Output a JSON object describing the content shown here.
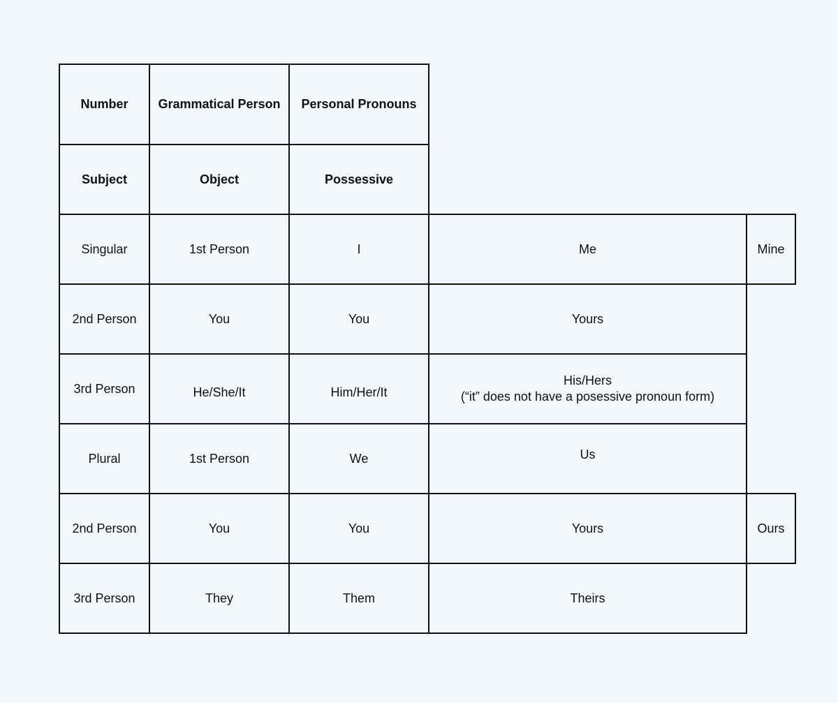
{
  "table": {
    "header_row_1": {
      "number": "Number",
      "grammatical_person": "Grammatical Person",
      "personal_pronouns": "Personal Pronouns"
    },
    "header_row_2": {
      "subject": "Subject",
      "object": "Object",
      "possessive": "Possessive"
    },
    "rows": [
      {
        "col1": "Singular",
        "col2": "1st Person",
        "col3": "I",
        "col4": "Me",
        "col5": "Mine"
      },
      {
        "col1": "2nd Person",
        "col2": "You",
        "col3": "You",
        "col4": "Yours"
      },
      {
        "col1": "3rd Person",
        "col2": "He/She/It",
        "col3": "Him/Her/It",
        "col4_line1": "His/Hers",
        "col4_line2": "(“it” does not have a posessive pronoun form)"
      },
      {
        "col1": "Plural",
        "col2": "1st Person",
        "col3": "We",
        "col4": "Us"
      },
      {
        "col1": "2nd Person",
        "col2": "You",
        "col3": "You",
        "col4": "Yours",
        "col5": "Ours"
      },
      {
        "col1": "3rd Person",
        "col2": "They",
        "col3": "Them",
        "col4": "Theirs"
      }
    ]
  }
}
